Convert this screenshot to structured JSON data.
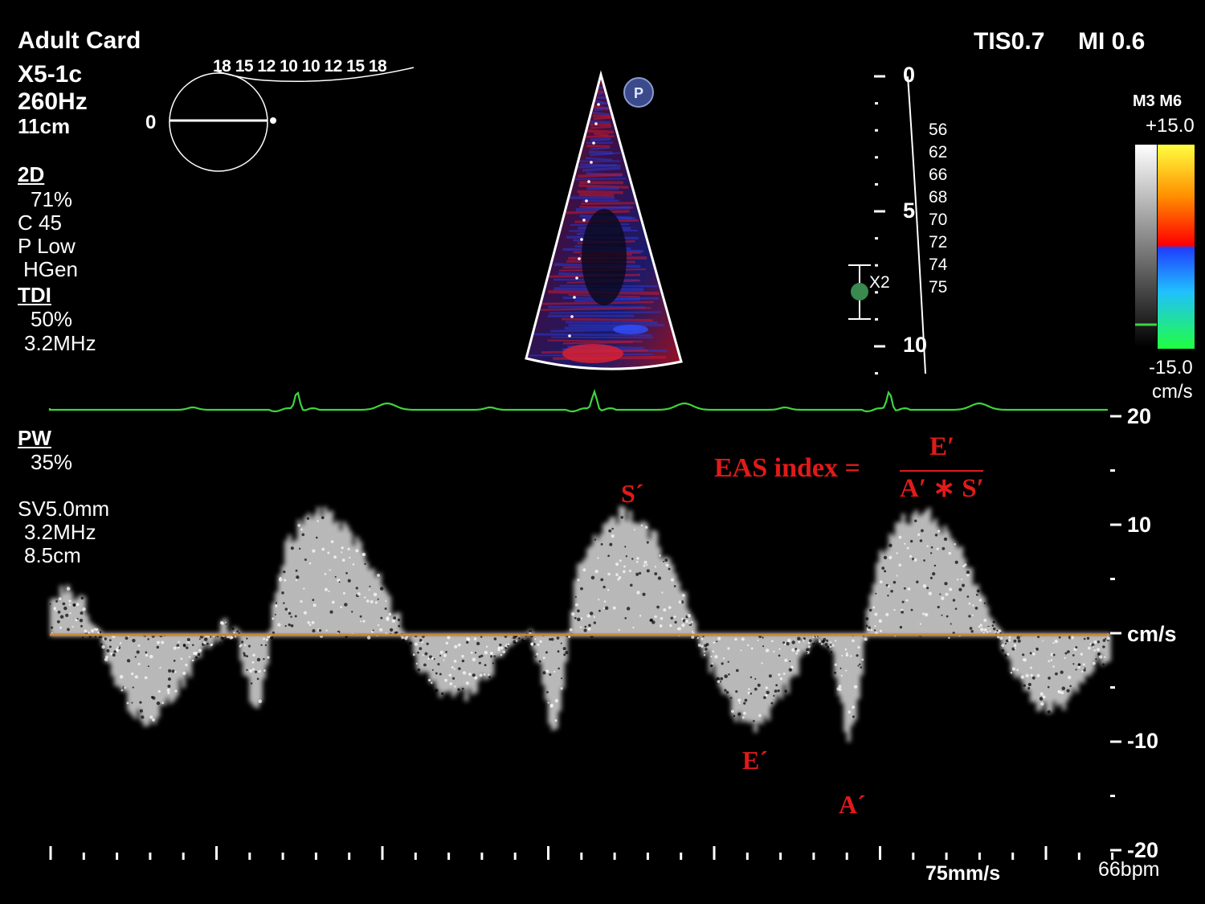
{
  "header": {
    "preset": "Adult Card",
    "transducer": "X5-1c",
    "frame_rate": "260Hz",
    "depth": "11cm",
    "thermal_index": "TIS0.7",
    "mech_index": "MI 0.6"
  },
  "probe_orientation": {
    "angle_value": "0",
    "scale_labels": "18 15 12 10 10 12 15 18"
  },
  "mode_2d": {
    "label": "2D",
    "gain": "71%",
    "compression": "C 45",
    "persistence": "P Low",
    "frequency_mode": "HGen"
  },
  "mode_tdi": {
    "label": "TDI",
    "gain": "50%",
    "frequency": "3.2MHz"
  },
  "mode_pw": {
    "label": "PW",
    "gain": "35%",
    "sample_volume": "SV5.0mm",
    "frequency": "3.2MHz",
    "gate_depth": "8.5cm"
  },
  "depth_scale": {
    "ticks": [
      "0",
      "5",
      "10"
    ],
    "gate_marker": "X2",
    "numbers": [
      "56",
      "62",
      "66",
      "68",
      "70",
      "72",
      "74",
      "75"
    ]
  },
  "color_bar": {
    "map_label": "M3 M6",
    "max": "+15.0",
    "min": "-15.0",
    "unit": "cm/s"
  },
  "velocity_scale": {
    "labels": [
      "20",
      "10",
      "cm/s",
      "-10",
      "-20"
    ]
  },
  "annotations": {
    "s_wave": "S´",
    "e_wave": "E´",
    "a_wave": "A´",
    "formula_lhs": "EAS index =",
    "formula_num": "E′",
    "formula_den": "A′ ∗ S′"
  },
  "footer": {
    "sweep_speed": "75mm/s",
    "heart_rate": "66bpm"
  },
  "colors": {
    "ecg": "#3fd43f",
    "baseline": "#c8873a",
    "annotation": "#e11a1a",
    "sector_red": "#c41a2a",
    "sector_blue": "#2233aa"
  }
}
